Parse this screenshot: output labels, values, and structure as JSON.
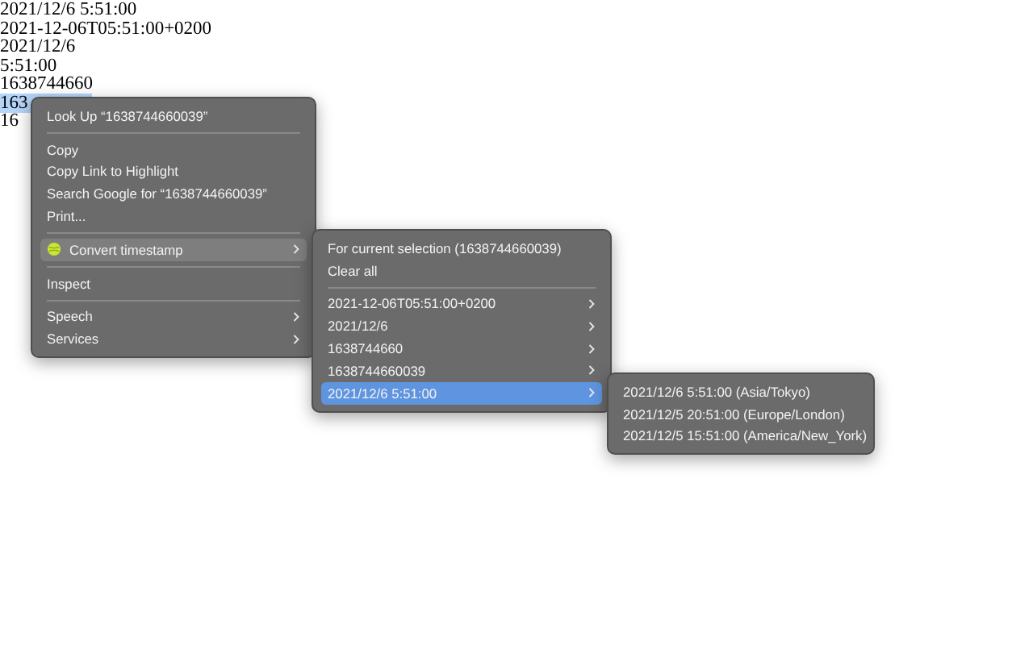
{
  "page_lines": [
    {
      "text": "2021/12/6 5:51:00",
      "selected": false
    },
    {
      "text": "2021-12-06T05:51:00+0200",
      "selected": false
    },
    {
      "text": "2021/12/6",
      "selected": false
    },
    {
      "text": "5:51:00",
      "selected": false
    },
    {
      "text": "1638744660",
      "selected": false
    },
    {
      "text": "163",
      "selected": true
    },
    {
      "text": "16",
      "selected": false
    }
  ],
  "context_menu": {
    "items": [
      {
        "kind": "item",
        "label": "Look Up “1638744660039”",
        "submenu": false,
        "selected": false
      },
      {
        "kind": "separator"
      },
      {
        "kind": "item",
        "label": "Copy",
        "submenu": false,
        "selected": false
      },
      {
        "kind": "item",
        "label": "Copy Link to Highlight",
        "submenu": false,
        "selected": false
      },
      {
        "kind": "item",
        "label": "Search Google for “1638744660039”",
        "submenu": false,
        "selected": false
      },
      {
        "kind": "item",
        "label": "Print...",
        "submenu": false,
        "selected": false
      },
      {
        "kind": "separator"
      },
      {
        "kind": "extension",
        "label": "Convert timestamp",
        "submenu": true,
        "selected": true
      },
      {
        "kind": "separator"
      },
      {
        "kind": "item",
        "label": "Inspect",
        "submenu": false,
        "selected": false
      },
      {
        "kind": "separator"
      },
      {
        "kind": "item",
        "label": "Speech",
        "submenu": true,
        "selected": false
      },
      {
        "kind": "item",
        "label": "Services",
        "submenu": true,
        "selected": false
      }
    ]
  },
  "submenu": {
    "items": [
      {
        "kind": "item",
        "label": "For current selection (1638744660039)",
        "submenu": false,
        "selected": false
      },
      {
        "kind": "item",
        "label": "Clear all",
        "submenu": false,
        "selected": false
      },
      {
        "kind": "separator"
      },
      {
        "kind": "item",
        "label": "2021-12-06T05:51:00+0200",
        "submenu": true,
        "selected": false
      },
      {
        "kind": "item",
        "label": "2021/12/6",
        "submenu": true,
        "selected": false
      },
      {
        "kind": "item",
        "label": "1638744660",
        "submenu": true,
        "selected": false
      },
      {
        "kind": "item",
        "label": "1638744660039",
        "submenu": true,
        "selected": false
      },
      {
        "kind": "item",
        "label": "2021/12/6 5:51:00",
        "submenu": true,
        "selected": true
      }
    ]
  },
  "timezone_menu": {
    "items": [
      {
        "kind": "item",
        "label": "2021/12/6 5:51:00 (Asia/Tokyo)",
        "submenu": false,
        "selected": false
      },
      {
        "kind": "item",
        "label": "2021/12/5 20:51:00 (Europe/London)",
        "submenu": false,
        "selected": false
      },
      {
        "kind": "item",
        "label": "2021/12/5 15:51:00 (America/New_York)",
        "submenu": false,
        "selected": false
      }
    ]
  }
}
